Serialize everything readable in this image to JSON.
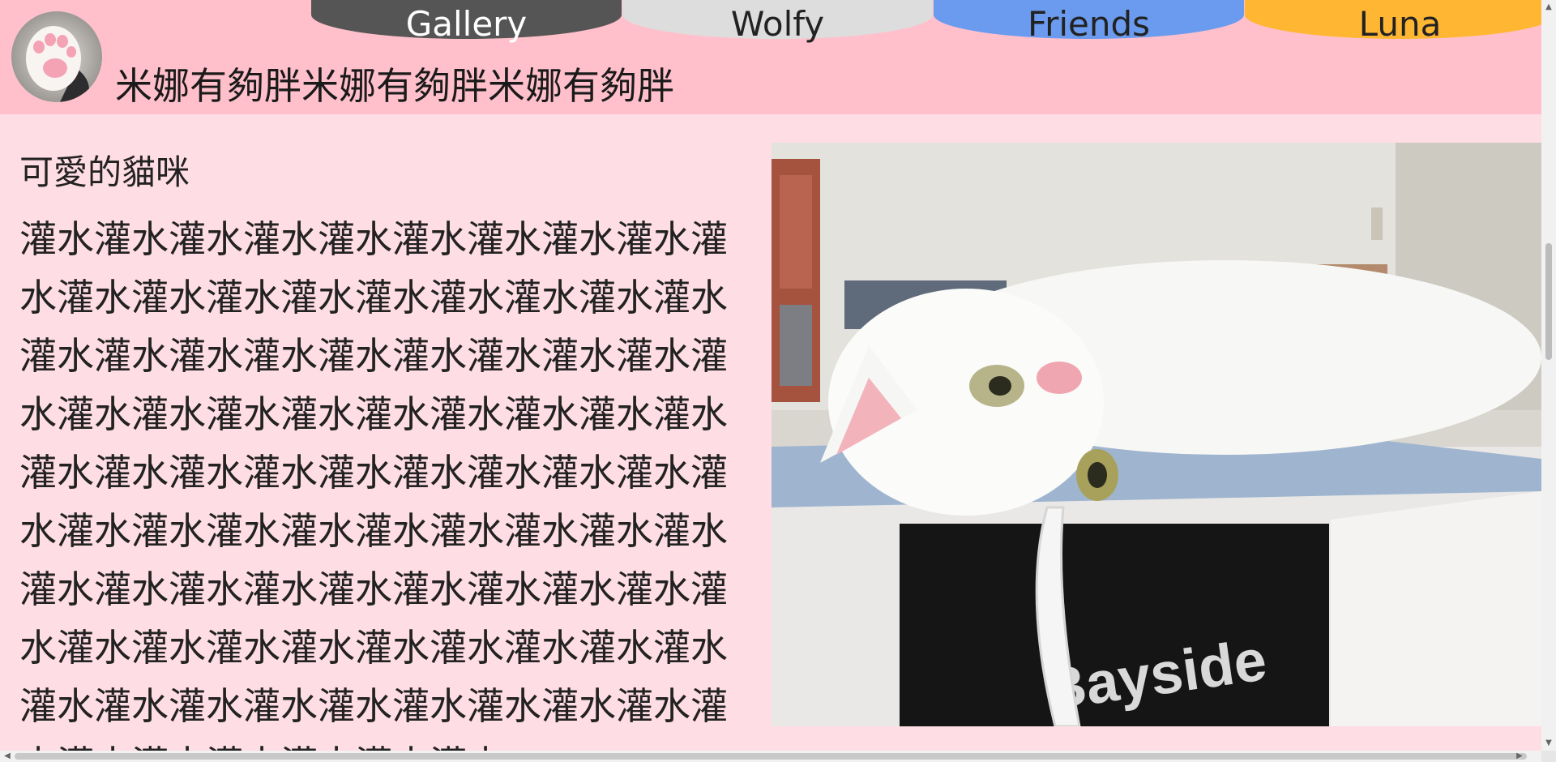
{
  "header": {
    "site_title": "米娜有夠胖米娜有夠胖米娜有夠胖",
    "avatar_icon": "cat-paw-icon"
  },
  "nav": {
    "tabs": [
      {
        "label": "Gallery",
        "bg": "#555555",
        "color": "#ffffff"
      },
      {
        "label": "Wolfy",
        "bg": "#dddddd",
        "color": "#222222"
      },
      {
        "label": "Friends",
        "bg": "#6b9bef",
        "color": "#222222"
      },
      {
        "label": "Luna",
        "bg": "#ffb733",
        "color": "#222222"
      }
    ]
  },
  "main": {
    "section_title": "可愛的貓咪",
    "body_text": "灌水灌水灌水灌水灌水灌水灌水灌水灌水灌水灌水灌水灌水灌水灌水灌水灌水灌水灌水灌水灌水灌水灌水灌水灌水灌水灌水灌水灌水灌水灌水灌水灌水灌水灌水灌水灌水灌水灌水灌水灌水灌水灌水灌水灌水灌水灌水灌水灌水灌水灌水灌水灌水灌水灌水灌水灌水灌水灌水灌水灌水灌水灌水灌水灌水灌水灌水灌水灌水灌水灌水灌水灌水灌水灌水灌水灌水灌水灌水灌水灌水灌水灌水灌水灌水灌水灌水灌水灌水灌水灌水灌水",
    "photo_box_text": "Bayside"
  },
  "colors": {
    "header_bg": "#ffc0cb",
    "page_bg": "#ffdde5"
  }
}
